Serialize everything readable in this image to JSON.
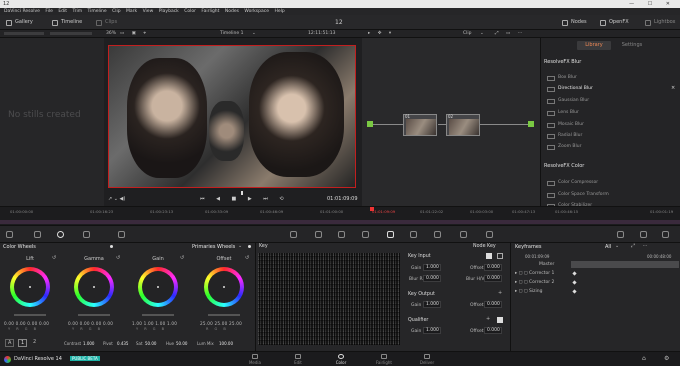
{
  "app": {
    "window_title": "12",
    "menu": [
      "DaVinci Resolve",
      "File",
      "Edit",
      "Trim",
      "Timeline",
      "Clip",
      "Mark",
      "View",
      "Playback",
      "Color",
      "Fairlight",
      "Nodes",
      "Workspace",
      "Help"
    ]
  },
  "toolbar": {
    "gallery": "Gallery",
    "timeline": "Timeline",
    "clips": "Clips",
    "project_name": "12",
    "nodes": "Nodes",
    "openfx": "OpenFX",
    "lightbox": "Lightbox"
  },
  "subbar": {
    "zoom": "36%",
    "timeline_name": "Timeline 1",
    "timecode": "12:11:51:13",
    "clip_mode": "Clip"
  },
  "gallery": {
    "empty_message": "No stills created"
  },
  "transport": {
    "timecode": "01:01:09:09"
  },
  "nodes": [
    {
      "label": "01"
    },
    {
      "label": "02"
    }
  ],
  "library": {
    "tabs": [
      "Library",
      "Settings"
    ],
    "sections": [
      {
        "title": "ResolveFX Blur",
        "items": [
          "Box Blur",
          "Directional Blur",
          "Gaussian Blur",
          "Lens Blur",
          "Mosaic Blur",
          "Radial Blur",
          "Zoom Blur"
        ]
      },
      {
        "title": "ResolveFX Color",
        "items": [
          "Color Compressor",
          "Color Space Transform",
          "Color Stabilizer"
        ]
      }
    ]
  },
  "timeline_timecodes": [
    "01:00:00:00",
    "01:00:16:23",
    "01:00:23:13",
    "01:00:33:09",
    "01:00:46:09",
    "01:01:00:00",
    "01:01:09:09",
    "01:01:22:02",
    "01:00:03:00",
    "01:00:47:13",
    "01:00:46:15",
    "01:00:01:19"
  ],
  "color_wheels": {
    "title": "Color Wheels",
    "mode": "Primaries Wheels",
    "wheels": [
      {
        "label": "Lift",
        "values": "0.00  0.00  0.00  0.00"
      },
      {
        "label": "Gamma",
        "values": "0.00  0.00  0.00  0.00"
      },
      {
        "label": "Gain",
        "values": "1.00  1.00  1.00  1.00"
      },
      {
        "label": "Offset",
        "values": "25.00  25.00  25.00"
      }
    ],
    "channel_labels": [
      "Y R G B",
      "Y R G B",
      "Y R G B",
      "R G B"
    ],
    "page_nums": [
      "A",
      "1",
      "2"
    ],
    "controls": {
      "contrast_label": "Contrast",
      "contrast": "1.000",
      "pivot_label": "Pivot",
      "pivot": "0.435",
      "sat_label": "Sat",
      "sat": "50.00",
      "hue_label": "Hue",
      "hue": "50.00",
      "lummix_label": "Lum Mix",
      "lummix": "100.00"
    }
  },
  "key": {
    "title": "Key",
    "node_key": "Node Key",
    "key_input": "Key Input",
    "key_output": "Key Output",
    "qualifier": "Qualifier",
    "gain_label": "Gain",
    "offset_label": "Offset",
    "blur_r_label": "Blur R.",
    "blur_h_label": "Blur H/V",
    "input_gain": "1.000",
    "input_offset": "0.000",
    "blur_r": "0.000",
    "blur_h": "0.000",
    "output_gain": "1.000",
    "output_offset": "0.000",
    "q_gain": "1.000",
    "q_offset": "0.000"
  },
  "keyframes": {
    "title": "Keyframes",
    "filter": "All",
    "timecode": "00:01:09:09",
    "ruler_end": "00:00:48:00",
    "rows": [
      "Master",
      "Corrector 1",
      "Corrector 2",
      "Sizing"
    ]
  },
  "footer": {
    "app_name": "DaVinci Resolve 14",
    "beta": "PUBLIC BETA",
    "pages": [
      "Media",
      "Edit",
      "Color",
      "Fairlight",
      "Deliver"
    ]
  }
}
